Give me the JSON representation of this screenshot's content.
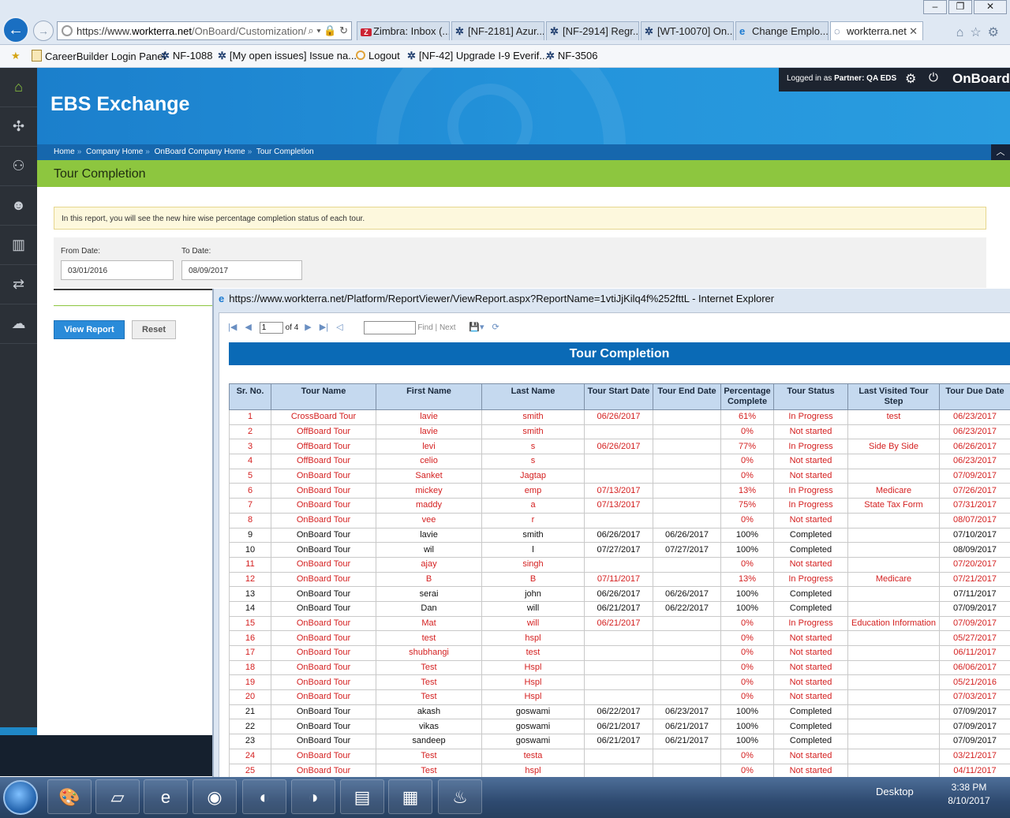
{
  "browser": {
    "url_prefix": "https://www.",
    "url_domain": "workterra.net",
    "url_path": "/OnBoard/Customization/",
    "tabs": [
      {
        "label": "Zimbra: Inbox (...",
        "icon": "zimbra-icon"
      },
      {
        "label": "[NF-2181] Azur...",
        "icon": "jira-icon"
      },
      {
        "label": "[NF-2914] Regr...",
        "icon": "jira-icon"
      },
      {
        "label": "[WT-10070] On...",
        "icon": "jira-icon"
      },
      {
        "label": "Change Emplo...",
        "icon": "ie-icon"
      },
      {
        "label": "workterra.net",
        "icon": "page-icon"
      }
    ],
    "favorites": [
      "CareerBuilder Login Panel",
      "NF-1088",
      "[My open issues] Issue na...",
      "Logout",
      "[NF-42] Upgrade I-9 Everif...",
      "NF-3506"
    ]
  },
  "app": {
    "title": "EBS Exchange",
    "logged_in_prefix": "Logged in as",
    "logged_in_user": "Partner: QA EDS",
    "brand": "OnBoard",
    "breadcrumb": [
      "Home",
      "Company Home",
      "OnBoard Company Home",
      "Tour Completion"
    ],
    "page_title": "Tour Completion",
    "info_text": "In this report, you will see the new hire wise percentage completion status of each tour.",
    "filters": {
      "from_label": "From Date:",
      "from_value": "03/01/2016",
      "to_label": "To Date:",
      "to_value": "08/09/2017"
    },
    "buttons": {
      "view": "View Report",
      "reset": "Reset"
    }
  },
  "popup": {
    "title": "https://www.workterra.net/Platform/ReportViewer/ViewReport.aspx?ReportName=1vtiJjKilq4f%252fttL - Internet Explorer",
    "toolbar": {
      "page": "1",
      "of": "of 4",
      "find": "Find",
      "sep": "|",
      "next": "Next"
    },
    "report_title": "Tour Completion",
    "columns": [
      "Sr. No.",
      "Tour Name",
      "First Name",
      "Last Name",
      "Tour Start Date",
      "Tour End Date",
      "Percentage Complete",
      "Tour Status",
      "Last Visited Tour Step",
      "Tour Due Date"
    ],
    "rows": [
      {
        "c": [
          "1",
          "CrossBoard Tour",
          "lavie",
          "smith",
          "06/26/2017",
          "",
          "61%",
          "In Progress",
          "test",
          "06/23/2017"
        ],
        "red": true
      },
      {
        "c": [
          "2",
          "OffBoard Tour",
          "lavie",
          "smith",
          "",
          "",
          "0%",
          "Not started",
          "",
          "06/23/2017"
        ],
        "red": true
      },
      {
        "c": [
          "3",
          "OffBoard Tour",
          "levi",
          "s",
          "06/26/2017",
          "",
          "77%",
          "In Progress",
          "Side By Side",
          "06/26/2017"
        ],
        "red": true
      },
      {
        "c": [
          "4",
          "OffBoard Tour",
          "celio",
          "s",
          "",
          "",
          "0%",
          "Not started",
          "",
          "06/23/2017"
        ],
        "red": true
      },
      {
        "c": [
          "5",
          "OnBoard Tour",
          "Sanket",
          "Jagtap",
          "",
          "",
          "0%",
          "Not started",
          "",
          "07/09/2017"
        ],
        "red": true
      },
      {
        "c": [
          "6",
          "OnBoard Tour",
          "mickey",
          "emp",
          "07/13/2017",
          "",
          "13%",
          "In Progress",
          "Medicare",
          "07/26/2017"
        ],
        "red": true
      },
      {
        "c": [
          "7",
          "OnBoard Tour",
          "maddy",
          "a",
          "07/13/2017",
          "",
          "75%",
          "In Progress",
          "State Tax Form",
          "07/31/2017"
        ],
        "red": true
      },
      {
        "c": [
          "8",
          "OnBoard Tour",
          "vee",
          "r",
          "",
          "",
          "0%",
          "Not started",
          "",
          "08/07/2017"
        ],
        "red": true
      },
      {
        "c": [
          "9",
          "OnBoard Tour",
          "lavie",
          "smith",
          "06/26/2017",
          "06/26/2017",
          "100%",
          "Completed",
          "",
          "07/10/2017"
        ],
        "red": false
      },
      {
        "c": [
          "10",
          "OnBoard Tour",
          "wil",
          "l",
          "07/27/2017",
          "07/27/2017",
          "100%",
          "Completed",
          "",
          "08/09/2017"
        ],
        "red": false
      },
      {
        "c": [
          "11",
          "OnBoard Tour",
          "ajay",
          "singh",
          "",
          "",
          "0%",
          "Not started",
          "",
          "07/20/2017"
        ],
        "red": true
      },
      {
        "c": [
          "12",
          "OnBoard Tour",
          "B",
          "B",
          "07/11/2017",
          "",
          "13%",
          "In Progress",
          "Medicare",
          "07/21/2017"
        ],
        "red": true
      },
      {
        "c": [
          "13",
          "OnBoard Tour",
          "serai",
          "john",
          "06/26/2017",
          "06/26/2017",
          "100%",
          "Completed",
          "",
          "07/11/2017"
        ],
        "red": false
      },
      {
        "c": [
          "14",
          "OnBoard Tour",
          "Dan",
          "will",
          "06/21/2017",
          "06/22/2017",
          "100%",
          "Completed",
          "",
          "07/09/2017"
        ],
        "red": false
      },
      {
        "c": [
          "15",
          "OnBoard Tour",
          "Mat",
          "will",
          "06/21/2017",
          "",
          "0%",
          "In Progress",
          "Education Information",
          "07/09/2017"
        ],
        "red": true
      },
      {
        "c": [
          "16",
          "OnBoard Tour",
          "test",
          "hspl",
          "",
          "",
          "0%",
          "Not started",
          "",
          "05/27/2017"
        ],
        "red": true
      },
      {
        "c": [
          "17",
          "OnBoard Tour",
          "shubhangi",
          "test",
          "",
          "",
          "0%",
          "Not started",
          "",
          "06/11/2017"
        ],
        "red": true
      },
      {
        "c": [
          "18",
          "OnBoard Tour",
          "Test",
          "Hspl",
          "",
          "",
          "0%",
          "Not started",
          "",
          "06/06/2017"
        ],
        "red": true
      },
      {
        "c": [
          "19",
          "OnBoard Tour",
          "Test",
          "Hspl",
          "",
          "",
          "0%",
          "Not started",
          "",
          "05/21/2016"
        ],
        "red": true
      },
      {
        "c": [
          "20",
          "OnBoard Tour",
          "Test",
          "Hspl",
          "",
          "",
          "0%",
          "Not started",
          "",
          "07/03/2017"
        ],
        "red": true
      },
      {
        "c": [
          "21",
          "OnBoard Tour",
          "akash",
          "goswami",
          "06/22/2017",
          "06/23/2017",
          "100%",
          "Completed",
          "",
          "07/09/2017"
        ],
        "red": false
      },
      {
        "c": [
          "22",
          "OnBoard Tour",
          "vikas",
          "goswami",
          "06/21/2017",
          "06/21/2017",
          "100%",
          "Completed",
          "",
          "07/09/2017"
        ],
        "red": false
      },
      {
        "c": [
          "23",
          "OnBoard Tour",
          "sandeep",
          "goswami",
          "06/21/2017",
          "06/21/2017",
          "100%",
          "Completed",
          "",
          "07/09/2017"
        ],
        "red": false
      },
      {
        "c": [
          "24",
          "OnBoard Tour",
          "Test",
          "testa",
          "",
          "",
          "0%",
          "Not started",
          "",
          "03/21/2017"
        ],
        "red": true
      },
      {
        "c": [
          "25",
          "OnBoard Tour",
          "Test",
          "hspl",
          "",
          "",
          "0%",
          "Not started",
          "",
          "04/11/2017"
        ],
        "red": true
      }
    ]
  },
  "taskbar": {
    "desktop_label": "Desktop",
    "time": "3:38 PM",
    "date": "8/10/2017"
  },
  "colors": {
    "header_blue": "#1b7fcc",
    "green_bar": "#8dc63f",
    "report_title_blue": "#0a6ab6",
    "status_red": "#d42020"
  }
}
